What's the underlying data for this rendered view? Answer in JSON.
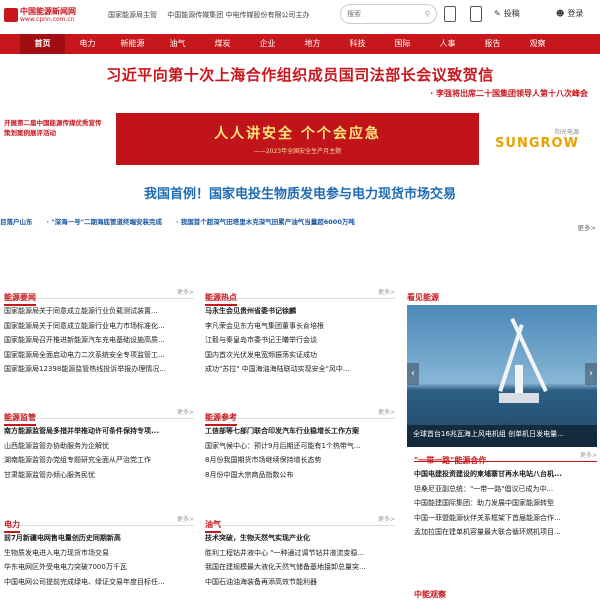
{
  "header": {
    "logo_name": "中国能源新闻网",
    "logo_url": "www.cpnn.com.cn",
    "links": [
      "国家能源局主管",
      "中国能源传媒集团 中电传媒股份有限公司主办"
    ],
    "search_placeholder": "搜索",
    "post_label": "投稿",
    "login_label": "登录"
  },
  "nav": [
    "首页",
    "电力",
    "新能源",
    "油气",
    "煤炭",
    "企业",
    "地方",
    "科技",
    "国际",
    "人事",
    "报告",
    "观察"
  ],
  "headline": "习近平向第十次上海合作组织成员国司法部长会议致贺信",
  "subline": "· 李强将出席二十国集团领导人第十八次峰会",
  "ads": {
    "left": "开展第二届中国能源传媒优秀宣传策划案例展评活动",
    "middle_title": "人人讲安全  个个会应急",
    "middle_sub": "——2023年全国安全生产月主题",
    "right_small": "阳光电源",
    "right_brand": "SUNGROW"
  },
  "blue_headline": "我国首例！国家电投生物质发电参与电力现货市场交易",
  "ticker": [
    "目落户山东",
    "·  \"深海一号\"二期海底管道终端安装完成",
    "·  我国首个超深气田塔里木克深气田累产油气当量超6000万吨"
  ],
  "more_label": "更多>",
  "sections": {
    "energy_news": {
      "title": "能源要闻",
      "items": [
        "国家能源局关于同意成立能源行业负载测试装置...",
        "国家能源局关于同意成立能源行业电力市场标准化...",
        "国家能源局召开推进新能源汽车充电基础设施高质...",
        "国家能源局全面启动电力二次系统安全专项监管工...",
        "国家能源局12398能源监管热线投诉举报办理情况..."
      ]
    },
    "energy_hot": {
      "title": "能源热点",
      "items": [
        "马永生会见贵州省委书记徐麟",
        "李凡荣会见东方电气集团董事长俞培根",
        "江毅与秦皇岛市委书记王曦举行会谈",
        "国内首次光伏发电宽频振荡实证成功",
        "成功\"苏拉\" 中国海油海陆联动实现安全\"风中..."
      ]
    },
    "photo": {
      "title": "看见能源",
      "caption": "全球首台16兆瓦海上风电机组 创单机日发电量..."
    },
    "supervision": {
      "title": "能源监管",
      "items": [
        "南方能源监管局多措并举推动许可条件保持专项...",
        "山西能源监管办协助服务为企解忧",
        "湖南能源监管办党组专题研究全面从严治党工作",
        "甘肃能源监管办倾心服务民忧"
      ]
    },
    "reference": {
      "title": "能源参考",
      "items": [
        "工信部等七部门联合印发汽车行业稳增长工作方案",
        "国家气候中心：预计9月后期还可能有1个热带气...",
        "8月份我国期货市场继续保持增长态势",
        "8月份中国大宗商品指数公布"
      ]
    },
    "belt_road": {
      "title": "\"一带一路\"能源合作",
      "items": [
        "中国电建投资建设的柬埔寨甘再水电站八台机...",
        "坦桑尼亚副总统：\"一带一路\"倡议已成为中...",
        "中国能建国际集团：助力发展中国家能源转型",
        "中国一菲盟能源伙伴关系框架下首届能源合作...",
        "孟加拉国在建单机容量最大联合循环燃机项目..."
      ]
    },
    "power": {
      "title": "电力",
      "items": [
        "前7月新疆电网售电量创历史同期新高",
        "生物质发电进入电力现货市场交易",
        "华东电网区外受电电力突破7000万千瓦",
        "中国电网公司提前完成绿电、绿证交易年度目标任..."
      ]
    },
    "oil_gas": {
      "title": "油气",
      "items": [
        "技术突破，生物天然气实现产业化",
        "胜利工程钻井液中心 \"一种通过调节钻井液流变稳...",
        "我国在建规模最大液化天然气储备基地接卸总量突...",
        "中国石油油海装备再添高效节能利器"
      ]
    },
    "observe": {
      "title": "中能观察"
    }
  }
}
